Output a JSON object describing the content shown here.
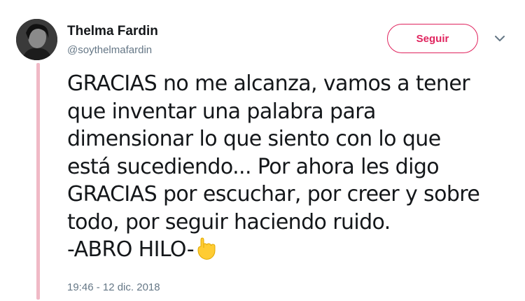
{
  "tweet": {
    "display_name": "Thelma Fardin",
    "handle": "@soythelmafardin",
    "follow_label": "Seguir",
    "text_lines": [
      "GRACIAS no me alcanza, vamos a tener",
      "que inventar una palabra para",
      "dimensionar lo que siento con lo que",
      "está sucediendo... Por ahora les digo",
      "GRACIAS por escuchar, por creer y sobre",
      "todo, por seguir haciendo ruido."
    ],
    "last_line": "-ABRO HILO-",
    "emoji_icon": "pointing-down-hand-icon",
    "timestamp": "19:46 - 12 dic. 2018"
  },
  "colors": {
    "accent": "#e0245e",
    "thread_line": "#f0b9c6",
    "secondary_text": "#657786",
    "primary_text": "#14171a"
  }
}
